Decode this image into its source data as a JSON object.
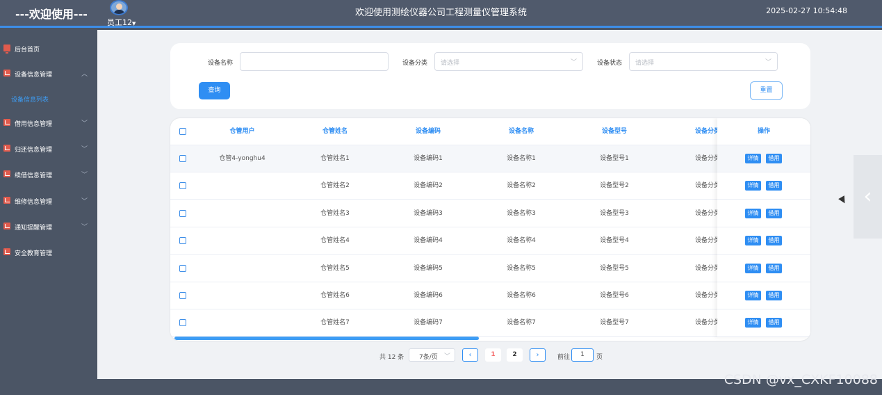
{
  "header": {
    "brand": "---欢迎使用---",
    "user_name": "员工12",
    "title": "欢迎使用测绘仪器公司工程测量仪管理系统",
    "datetime": "2025-02-27 10:54:48"
  },
  "sidebar": {
    "items": [
      {
        "label": "后台首页",
        "icon": "monitor-icon",
        "expanded": null
      },
      {
        "label": "设备信息管理",
        "icon": "chart-icon",
        "expanded": true
      },
      {
        "label": "借用信息管理",
        "icon": "chart-icon",
        "expanded": false
      },
      {
        "label": "归还信息管理",
        "icon": "chart-icon",
        "expanded": false
      },
      {
        "label": "续借信息管理",
        "icon": "chart-icon",
        "expanded": false
      },
      {
        "label": "维修信息管理",
        "icon": "chart-icon",
        "expanded": false
      },
      {
        "label": "通知提醒管理",
        "icon": "chart-icon",
        "expanded": false
      },
      {
        "label": "安全教育管理",
        "icon": "chart-icon",
        "expanded": null
      }
    ],
    "sub_item": "设备信息列表",
    "arrow_up": "︿",
    "arrow_down": "﹀"
  },
  "search": {
    "name_label": "设备名称",
    "name_value": "",
    "category_label": "设备分类",
    "category_placeholder": "请选择",
    "status_label": "设备状态",
    "status_placeholder": "请选择",
    "query_button": "查询",
    "reset_button": "重置"
  },
  "table": {
    "columns": [
      "仓管用户",
      "仓管姓名",
      "设备编码",
      "设备名称",
      "设备型号",
      "设备分类"
    ],
    "action_header": "操作",
    "detail_button": "详情",
    "borrow_button": "借用",
    "rows": [
      {
        "user": "仓管4-yonghu4",
        "name": "仓管姓名1",
        "code": "设备编码1",
        "device": "设备名称1",
        "model": "设备型号1",
        "category": "设备分类"
      },
      {
        "user": "",
        "name": "仓管姓名2",
        "code": "设备编码2",
        "device": "设备名称2",
        "model": "设备型号2",
        "category": "设备分类"
      },
      {
        "user": "",
        "name": "仓管姓名3",
        "code": "设备编码3",
        "device": "设备名称3",
        "model": "设备型号3",
        "category": "设备分类"
      },
      {
        "user": "",
        "name": "仓管姓名4",
        "code": "设备编码4",
        "device": "设备名称4",
        "model": "设备型号4",
        "category": "设备分类"
      },
      {
        "user": "",
        "name": "仓管姓名5",
        "code": "设备编码5",
        "device": "设备名称5",
        "model": "设备型号5",
        "category": "设备分类"
      },
      {
        "user": "",
        "name": "仓管姓名6",
        "code": "设备编码6",
        "device": "设备名称6",
        "model": "设备型号6",
        "category": "设备分类"
      },
      {
        "user": "",
        "name": "仓管姓名7",
        "code": "设备编码7",
        "device": "设备名称7",
        "model": "设备型号7",
        "category": "设备分类"
      }
    ]
  },
  "pagination": {
    "total": "共 12 条",
    "page_size": "7条/页",
    "prev": "‹",
    "next": "›",
    "pages": [
      "1",
      "2"
    ],
    "current_page": "1",
    "goto_label": "前往",
    "goto_value": "1",
    "goto_suffix": "页"
  },
  "carousel_arrow": "‹",
  "watermark": "CSDN @vx_CXKF10088",
  "colors": {
    "accent": "#2f8ef3",
    "header_bg": "#505a6c",
    "sidebar_bg": "#4b5565",
    "icon_red": "#e15b4d"
  }
}
